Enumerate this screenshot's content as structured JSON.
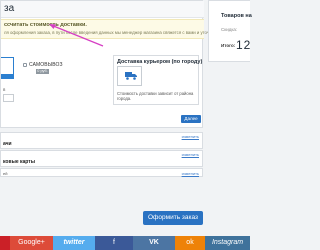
{
  "step": {
    "title": "за"
  },
  "notice": {
    "title": "ссчитать стоимость доставки.",
    "text": "ля оформления заказа, в пути после введения данных мы менеджер магазина свяжется с вами и уточнит информацию по"
  },
  "delivery": {
    "self_pickup_label": "САМОВЫВОЗ",
    "self_pickup_price": "0 руб.",
    "courier_title": "Доставка курьером (по городу)",
    "courier_note": "Стоимость доставки зависит от района города."
  },
  "form": {
    "small_label": "в"
  },
  "buttons": {
    "next": "Далее",
    "order": "Оформить заказ"
  },
  "rows": [
    {
      "edit": "изменить",
      "label": "ачи"
    },
    {
      "edit": "изменить",
      "label": "ковые карты"
    },
    {
      "edit": "изменить",
      "label": "ей"
    }
  ],
  "sidebar": {
    "title": "Товаров на",
    "subtitle": "Скидка:",
    "total_label": "Итого:",
    "total_value": "12"
  },
  "social": {
    "pinterest": "",
    "googleplus": "Google+",
    "twitter": "twitter",
    "facebook": "f",
    "vk": "VK",
    "ok": "ok",
    "instagram": "Instagram"
  },
  "colors": {
    "accent": "#2a72c2",
    "notice_bg": "#fdfae6",
    "arrow": "#d63fc4"
  }
}
